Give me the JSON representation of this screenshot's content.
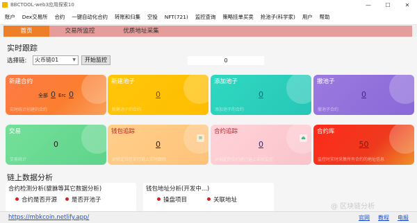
{
  "window": {
    "title": "BBCTOOL-web3应用探索10",
    "minimize": "—",
    "maximize": "☐",
    "close": "✕"
  },
  "menu": [
    "账户",
    "Dex交易所",
    "合约",
    "一键自动化合约",
    "转账和归集",
    "空投",
    "NFT(721)",
    "监控查询",
    "策略挂单买卖",
    "抢池子(科学家)",
    "用户",
    "帮助"
  ],
  "tabs": [
    "首页",
    "交易所监控",
    "优质地址采集"
  ],
  "realtime": {
    "title": "实时跟踪",
    "exchange_label": "选择链:",
    "exchange_value": "火币链01",
    "start_button": "开始监控",
    "counter": "0"
  },
  "cards": {
    "new_contract": {
      "title": "新建合约",
      "all_label": "全部",
      "all_value": "0",
      "erc_label": "Erc",
      "erc_value": "0",
      "note": "实时统计创建的合约"
    },
    "new_pool": {
      "title": "新建池子",
      "value": "0",
      "note": "新建池子的合约"
    },
    "add_pool": {
      "title": "添加池子",
      "value": "0",
      "note": "添加池子的合约"
    },
    "remove_pool": {
      "title": "撤池子",
      "value": "0",
      "note": "撤池子合约"
    },
    "trade": {
      "title": "交易",
      "value": "0",
      "note": "交易统计"
    },
    "wallet_track": {
      "title": "钱包追踪",
      "value": "0",
      "note": "对特定钱包实行链上实时跟踪"
    },
    "contract_track": {
      "title": "合约追踪",
      "value": "0",
      "note": "对指定的合约进行链上实时监控"
    },
    "contract_lib": {
      "title": "合约库",
      "value": "50",
      "note": "监控时实时采集所有合约的地址信息"
    }
  },
  "analysis": {
    "title": "链上数据分析",
    "contract_panel": {
      "title": "合约检测分析(貔貅等其它数据分析)",
      "items": [
        "合约是否开源",
        "是否开池子"
      ]
    },
    "wallet_panel": {
      "title": "钱包地址分析(开发中...)",
      "items": [
        "操盘项目",
        "关联地址"
      ]
    }
  },
  "status": {
    "url": "https://mbkcoin.netlify.app/",
    "links": [
      "官网",
      "教程",
      "电报"
    ]
  },
  "watermark": "@ 区块链分析"
}
